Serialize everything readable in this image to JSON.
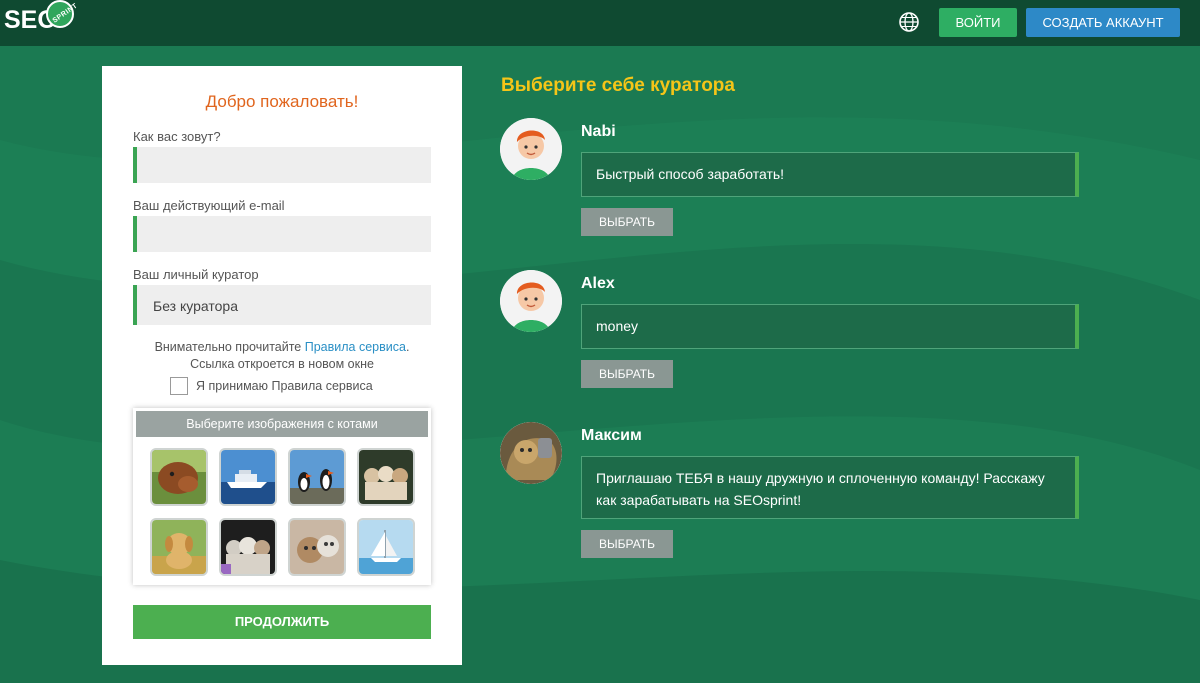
{
  "header": {
    "logo_text": "SEO",
    "logo_badge": "SPRINT",
    "login_label": "ВОЙТИ",
    "signup_label": "СОЗДАТЬ АККАУНТ"
  },
  "form": {
    "welcome": "Добро пожаловать!",
    "name_label": "Как вас зовут?",
    "name_value": "",
    "email_label": "Ваш действующий e-mail",
    "email_value": "",
    "curator_label": "Ваш личный куратор",
    "curator_value": "Без куратора",
    "rules_prefix": "Внимательно прочитайте ",
    "rules_link": "Правила сервиса",
    "rules_suffix": ".",
    "rules_line2": "Ссылка откроется в новом окне",
    "accept_label": "Я принимаю Правила сервиса",
    "captcha_title": "Выберите изображения с котами",
    "captcha_images": [
      "cow-image",
      "yacht-image",
      "puffins-image",
      "cats-image",
      "puppy-image",
      "kittens-image",
      "cat-image",
      "sailboat-image"
    ],
    "continue_label": "ПРОДОЛЖИТЬ"
  },
  "curators": {
    "title": "Выберите себе куратора",
    "items": [
      {
        "name": "Nabi",
        "message": "Быстрый способ заработать!",
        "button": "ВЫБРАТЬ",
        "avatar": "boy-avatar"
      },
      {
        "name": "Alex",
        "message": "money",
        "button": "ВЫБРАТЬ",
        "avatar": "boy-avatar"
      },
      {
        "name": "Максим",
        "message": "Приглашаю ТЕБЯ в нашу дружную и сплоченную команду! Расскажу как зарабатывать на SEOsprint!",
        "button": "ВЫБРАТЬ",
        "avatar": "photo-avatar"
      }
    ]
  },
  "colors": {
    "background": "#1b7a52",
    "header": "#0f4a31",
    "accent_green": "#4caf50",
    "login_green": "#2eae63",
    "signup_blue": "#2d89c7",
    "title_yellow": "#f5c518",
    "welcome_orange": "#e0651e"
  }
}
